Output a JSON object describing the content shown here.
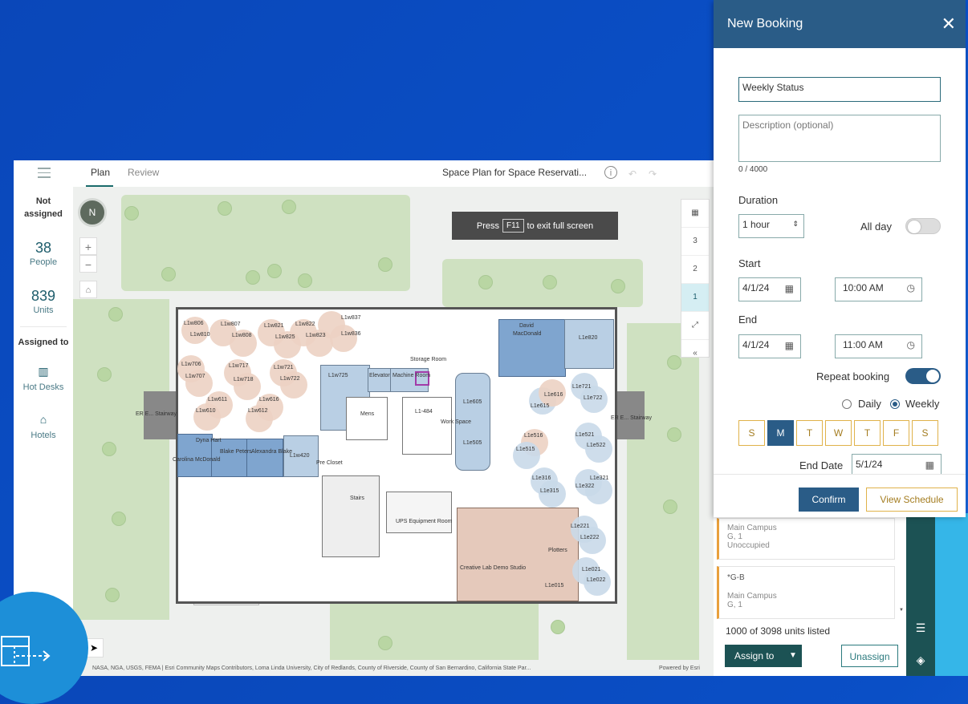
{
  "app": {
    "tabs": [
      {
        "label": "Plan"
      },
      {
        "label": "Review"
      }
    ],
    "plan_title": "Space Plan for Space Reservati...",
    "info_glyph": "i",
    "fullscreen": {
      "press": "Press",
      "key": "F11",
      "suffix": "to exit full screen"
    }
  },
  "left_stats": {
    "not_assigned_line1": "Not",
    "not_assigned_line2": "assigned",
    "people_count": "38",
    "people_label": "People",
    "units_count": "839",
    "units_label": "Units",
    "assigned_to": "Assigned to",
    "hot_desks": "Hot Desks",
    "hotels": "Hotels"
  },
  "map": {
    "floors": [
      "3",
      "2",
      "1"
    ],
    "active_floor": "1",
    "zoom_in": "+",
    "zoom_out": "−",
    "compass": "N",
    "attribution": "NASA, NGA, USGS, FEMA | Esri Community Maps Contributors, Loma Linda University, City of Redlands, County of Riverside, County of San Bernardino, California State Par...",
    "powered_by": "Powered by Esri",
    "labels": {
      "l1w806": "L1w806",
      "l1w807": "L1w807",
      "l1w810": "L1w810",
      "l1w808": "L1w808",
      "l1w821": "L1w821",
      "l1w822": "L1w822",
      "l1w825": "L1w825",
      "l1w823": "L1w823",
      "l1w837": "L1w837",
      "l1w836": "L1w836",
      "l1w706": "L1w706",
      "l1w707": "L1w707",
      "l1w717": "L1w717",
      "l1w718": "L1w718",
      "l1w721": "L1w721",
      "l1w722": "L1w722",
      "l1w611": "L1w611",
      "l1w610": "L1w610",
      "l1w616": "L1w616",
      "l1w612": "L1w612",
      "l1w725": "L1w725",
      "elevator": "Elevator",
      "machine_room": "Machine Room",
      "storage_room": "Storage Room",
      "mens": "Mens",
      "l1_484": "L1-484",
      "work_space": "Work Space",
      "l1e605": "L1e605",
      "l1e505": "L1e505",
      "david": "David",
      "macdonald": "MacDonald",
      "l1e820": "L1e820",
      "l1e616": "L1e616",
      "l1e615": "L1e615",
      "l1e721": "L1e721",
      "l1e722": "L1e722",
      "l1e516": "L1e516",
      "l1e515": "L1e515",
      "l1e521": "L1e521",
      "l1e522": "L1e522",
      "l1e316": "L1e316",
      "l1e315": "L1e315",
      "l1e321": "L1e321",
      "l1e322": "L1e322",
      "l1e221": "L1e221",
      "l1e222": "L1e222",
      "l1e021": "L1e021",
      "l1e022": "L1e022",
      "l1e015": "L1e015",
      "er_west": "ER E... Stairway",
      "er_east": "ER E... Stairway",
      "dyna_hart": "Dyna Hart",
      "carolina": "Carolina McDonald",
      "blake": "Blake Peters",
      "alexandra": "Alexandra Blake",
      "l1w420": "L1w420",
      "pre_closet": "Pre Closet",
      "stairs": "Stairs",
      "ups": "UPS Equipment Room",
      "plotters": "Plotters",
      "creative_lab": "Creative Lab Demo Studio",
      "l1_label": "L1"
    }
  },
  "booking": {
    "title": "New Booking",
    "title_value": "Weekly Status",
    "description_placeholder": "Description (optional)",
    "char_count": "0 / 4000",
    "duration_label": "Duration",
    "duration_value": "1 hour",
    "all_day_label": "All day",
    "all_day_on": false,
    "start_label": "Start",
    "start_date": "4/1/24",
    "start_time": "10:00 AM",
    "end_label": "End",
    "end_date": "4/1/24",
    "end_time": "11:00 AM",
    "repeat_label": "Repeat booking",
    "repeat_on": true,
    "daily_label": "Daily",
    "weekly_label": "Weekly",
    "frequency": "Weekly",
    "days": [
      "S",
      "M",
      "T",
      "W",
      "T",
      "F",
      "S"
    ],
    "selected_day_index": 1,
    "end_date_label": "End Date",
    "end_date_value": "5/1/24",
    "confirm_label": "Confirm",
    "view_schedule_label": "View Schedule"
  },
  "unit_list": {
    "cards": [
      {
        "line1": "Main Campus",
        "line2": "G, 1",
        "line3": "Unoccupied"
      },
      {
        "title": "*G-B",
        "line1": "Main Campus",
        "line2": "G, 1"
      }
    ],
    "count_text": "1000 of 3098 units listed",
    "assign_label": "Assign to",
    "unassign_label": "Unassign"
  },
  "colors": {
    "background": "#0a47b9",
    "booking_header": "#2a5c87",
    "accent_gold": "#e0b24a",
    "teal_dark": "#1c5254",
    "toggle_on": "#2a5c87"
  },
  "icons": {
    "close": "close-icon",
    "calendar": "calendar-icon",
    "clock": "clock-icon",
    "home": "home-icon",
    "list": "list-icon",
    "layers": "layers-icon",
    "hot_desks": "hot-desk-icon",
    "hotels": "hotel-icon"
  }
}
